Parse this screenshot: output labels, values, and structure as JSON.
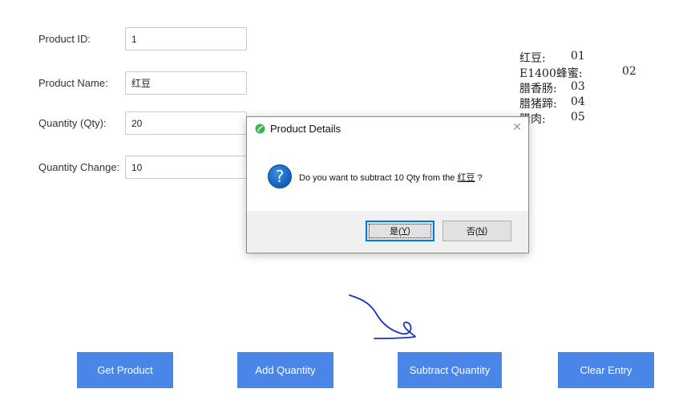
{
  "form": {
    "product_id_label": "Product ID:",
    "product_id_value": "1",
    "product_name_label": "Product Name:",
    "product_name_value": "红豆",
    "quantity_label": "Quantity (Qty):",
    "quantity_value": "20",
    "quantity_change_label": "Quantity Change:",
    "quantity_change_value": "10"
  },
  "product_codes": [
    {
      "name": "红豆:",
      "code": "01"
    },
    {
      "name": "E1400蜂蜜:",
      "code": "02"
    },
    {
      "name": "腊香肠:",
      "code": "03"
    },
    {
      "name": "腊猪蹄:",
      "code": "04"
    },
    {
      "name": "腊肉:",
      "code": "05"
    }
  ],
  "buttons": {
    "get_product": "Get Product",
    "add_quantity": "Add Quantity",
    "subtract_quantity": "Subtract Quantity",
    "clear_entry": "Clear Entry"
  },
  "dialog": {
    "title": "Product Details",
    "close_glyph": "✕",
    "question_glyph": "?",
    "message_prefix": "Do you want to subtract 10 Qty from the ",
    "message_product": "红豆",
    "message_suffix": " ?",
    "yes_text": "是(",
    "yes_key": "Y",
    "yes_close": ")",
    "no_text": "否(",
    "no_key": "N",
    "no_close": ")"
  },
  "colors": {
    "button_blue": "#4a86e8",
    "annotation_ink": "#1f2fbf"
  }
}
